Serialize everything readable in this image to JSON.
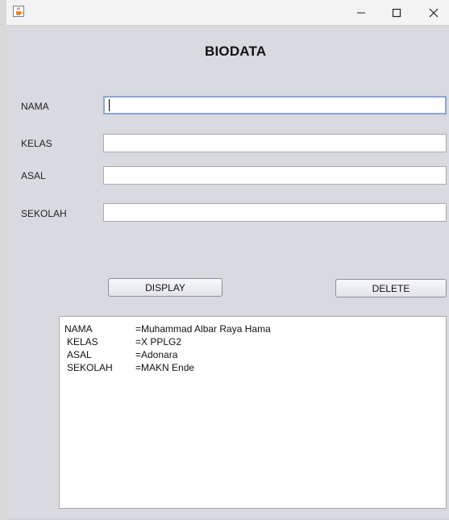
{
  "titlebar": {
    "icon": "java-cup-icon",
    "minimize_icon": "minimize-icon",
    "maximize_icon": "maximize-icon",
    "close_icon": "close-icon"
  },
  "form": {
    "title": "BIODATA",
    "fields": [
      {
        "label": "NAMA",
        "value": ""
      },
      {
        "label": "KELAS",
        "value": ""
      },
      {
        "label": "ASAL",
        "value": ""
      },
      {
        "label": "SEKOLAH",
        "value": ""
      }
    ],
    "display_button": "DISPLAY",
    "delete_button": "DELETE"
  },
  "output": {
    "lines": [
      {
        "key": "NAMA",
        "value": "=Muhammad Albar Raya Hama"
      },
      {
        "key": "KELAS",
        "value": "=X PPLG2"
      },
      {
        "key": "ASAL",
        "value": "=Adonara"
      },
      {
        "key": "SEKOLAH",
        "value": "=MAKN Ende"
      }
    ]
  },
  "colors": {
    "background": "#d8dae0",
    "focus_border": "#8aa6d0"
  }
}
